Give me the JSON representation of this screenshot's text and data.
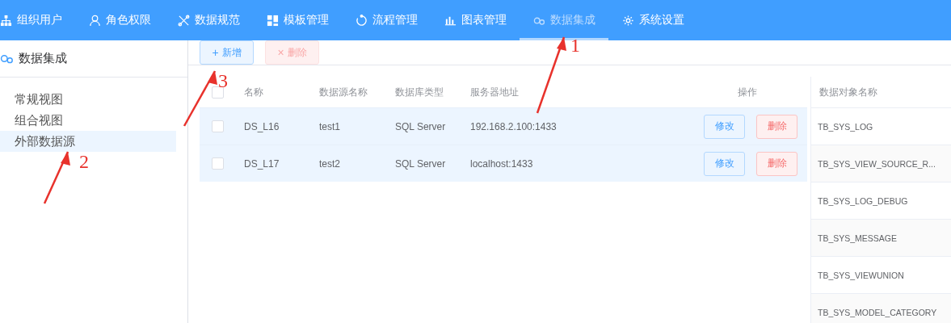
{
  "nav": {
    "items": [
      {
        "label": "组织用户",
        "selected": false
      },
      {
        "label": "角色权限",
        "selected": false
      },
      {
        "label": "数据规范",
        "selected": false
      },
      {
        "label": "模板管理",
        "selected": false
      },
      {
        "label": "流程管理",
        "selected": false
      },
      {
        "label": "图表管理",
        "selected": false
      },
      {
        "label": "数据集成",
        "selected": true
      },
      {
        "label": "系统设置",
        "selected": false
      }
    ]
  },
  "sidebar": {
    "title": "数据集成",
    "items": [
      {
        "label": "常规视图",
        "selected": false
      },
      {
        "label": "组合视图",
        "selected": false
      },
      {
        "label": "外部数据源",
        "selected": true
      }
    ]
  },
  "toolbar": {
    "buttons": [
      {
        "icon": "+",
        "label": "新增",
        "disabled": false
      },
      {
        "icon": "×",
        "label": "删除",
        "disabled": true
      }
    ]
  },
  "table": {
    "columns": [
      "名称",
      "数据源名称",
      "数据库类型",
      "服务器地址",
      "操作"
    ],
    "header_checked": false,
    "rows": [
      {
        "checked": false,
        "highlighted": true,
        "cells": [
          "DS_L16",
          "test1",
          "SQL Server",
          "192.168.2.100:1433"
        ],
        "actions": [
          {
            "kind": "edit",
            "label": "修改"
          },
          {
            "kind": "delete",
            "label": "删除"
          }
        ]
      },
      {
        "checked": false,
        "highlighted": true,
        "cells": [
          "DS_L17",
          "test2",
          "SQL Server",
          "localhost:1433"
        ],
        "actions": [
          {
            "kind": "edit",
            "label": "修改"
          },
          {
            "kind": "delete",
            "label": "删除"
          }
        ]
      }
    ]
  },
  "objects": {
    "heading": "数据对象名称",
    "rows": [
      "TB_SYS_LOG",
      "TB_SYS_VIEW_SOURCE_R...",
      "TB_SYS_LOG_DEBUG",
      "TB_SYS_MESSAGE",
      "TB_SYS_VIEWUNION",
      "TB_SYS_MODEL_CATEGORY"
    ]
  },
  "annotations": [
    "1",
    "2",
    "3"
  ]
}
